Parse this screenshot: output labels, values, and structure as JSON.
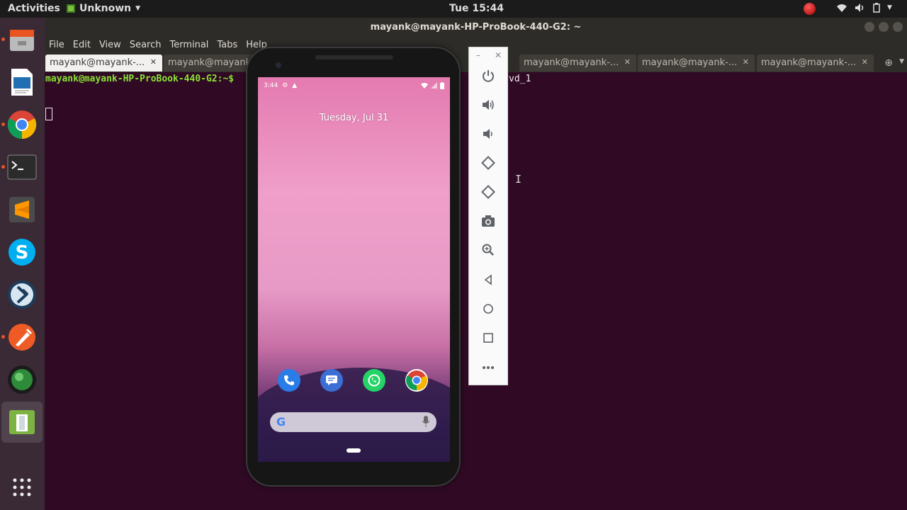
{
  "topbar": {
    "activities": "Activities",
    "app_name": "Unknown",
    "clock": "Tue 15:44"
  },
  "launcher": {
    "apps": [
      "files-icon",
      "libreoffice-writer-icon",
      "chrome-icon",
      "terminal-icon",
      "sublime-text-icon",
      "skype-icon",
      "kodi-icon",
      "postman-icon",
      "globe-icon",
      "android-studio-icon",
      "show-apps-icon"
    ]
  },
  "terminal": {
    "window_title": "mayank@mayank-HP-ProBook-440-G2: ~",
    "menu": [
      "File",
      "Edit",
      "View",
      "Search",
      "Terminal",
      "Tabs",
      "Help"
    ],
    "tabs": [
      "mayank@mayank-...",
      "mayank@mayank-...",
      "mayank@mayank-...",
      "mayank@mayank-...",
      "mayank@mayank-..."
    ],
    "prompt": "mayank@mayank-HP-ProBook-440-G2:~$",
    "prompt_tail": "vd_1"
  },
  "phone": {
    "status_time": "3:44",
    "date": "Tuesday, Jul 31",
    "dock": [
      "phone-icon",
      "messages-icon",
      "whatsapp-icon",
      "chrome-icon"
    ],
    "search_logo": "G"
  },
  "emulator_toolbar": {
    "buttons": [
      "power-icon",
      "volume-up-icon",
      "volume-down-icon",
      "rotate-left-icon",
      "rotate-right-icon",
      "camera-icon",
      "zoom-icon",
      "back-icon",
      "home-icon",
      "overview-icon",
      "more-icon"
    ]
  },
  "colors": {
    "terminal_bg": "#300a24",
    "prompt_green": "#8ae234",
    "launcher_bg": "#3a2a36"
  }
}
